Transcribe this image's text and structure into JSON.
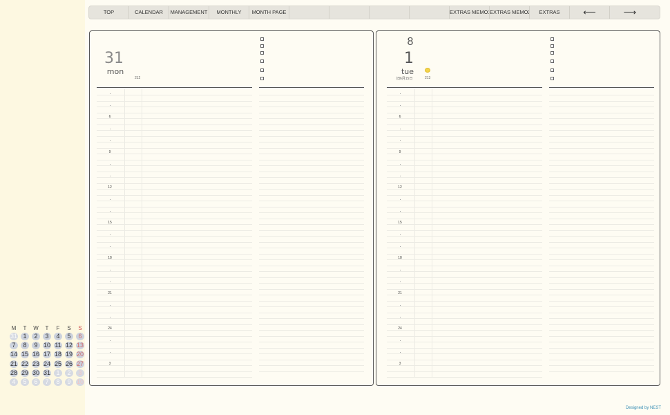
{
  "nav": {
    "items": [
      "TOP",
      "CALENDAR",
      "MANAGEMENT",
      "MONTHLY",
      "MONTH PAGE",
      "",
      "",
      "",
      "",
      "EXTRAS MEMO1",
      "EXTRAS MEMO2",
      "EXTRAS",
      "⟵",
      "⟶"
    ]
  },
  "left_page": {
    "day": "31",
    "weekday": "mon",
    "day_of_year": "212"
  },
  "right_page": {
    "month": "8",
    "day": "1",
    "weekday": "tue",
    "rokuyo": "旧6月15日",
    "day_of_year": "213",
    "weather_icon": "sun-icon"
  },
  "hour_labels": [
    "",
    "",
    "6",
    "",
    "",
    "9",
    "",
    "",
    "12",
    "",
    "",
    "15",
    "",
    "",
    "18",
    "",
    "",
    "21",
    "",
    "",
    "24",
    "",
    "",
    "3"
  ],
  "mini_calendar": {
    "weekdays": [
      "M",
      "T",
      "W",
      "T",
      "F",
      "S",
      "S"
    ],
    "weeks": [
      [
        {
          "d": "31",
          "o": true
        },
        {
          "d": "1"
        },
        {
          "d": "2"
        },
        {
          "d": "3"
        },
        {
          "d": "4"
        },
        {
          "d": "5"
        },
        {
          "d": "6"
        }
      ],
      [
        {
          "d": "7"
        },
        {
          "d": "8"
        },
        {
          "d": "9"
        },
        {
          "d": "10"
        },
        {
          "d": "11"
        },
        {
          "d": "12"
        },
        {
          "d": "13"
        }
      ],
      [
        {
          "d": "14"
        },
        {
          "d": "15"
        },
        {
          "d": "16"
        },
        {
          "d": "17"
        },
        {
          "d": "18"
        },
        {
          "d": "19"
        },
        {
          "d": "20"
        }
      ],
      [
        {
          "d": "21"
        },
        {
          "d": "22"
        },
        {
          "d": "23"
        },
        {
          "d": "24"
        },
        {
          "d": "25"
        },
        {
          "d": "26"
        },
        {
          "d": "27"
        }
      ],
      [
        {
          "d": "28"
        },
        {
          "d": "29"
        },
        {
          "d": "30"
        },
        {
          "d": "31"
        },
        {
          "d": "1",
          "o": true
        },
        {
          "d": "2",
          "o": true
        },
        {
          "d": "3",
          "o": true
        }
      ],
      [
        {
          "d": "4",
          "o": true
        },
        {
          "d": "5",
          "o": true
        },
        {
          "d": "6",
          "o": true
        },
        {
          "d": "7",
          "o": true
        },
        {
          "d": "8",
          "o": true
        },
        {
          "d": "9",
          "o": true
        },
        {
          "d": "10",
          "o": true
        }
      ]
    ]
  },
  "credit": "Designed by NEST",
  "colors": {
    "background": "#fefcf3",
    "sidebar": "#fdf8e1",
    "accent": "#3a8fb5",
    "sunday": "#d05050"
  }
}
